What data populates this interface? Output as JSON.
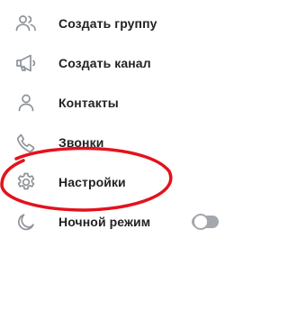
{
  "menu": {
    "items": [
      {
        "label": "Создать группу",
        "icon": "group-icon"
      },
      {
        "label": "Создать канал",
        "icon": "megaphone-icon"
      },
      {
        "label": "Контакты",
        "icon": "person-icon"
      },
      {
        "label": "Звонки",
        "icon": "phone-icon"
      },
      {
        "label": "Настройки",
        "icon": "gear-icon"
      },
      {
        "label": "Ночной режим",
        "icon": "moon-icon",
        "toggle_on": false
      }
    ]
  },
  "colors": {
    "icon": "#8e9399",
    "text": "#222222",
    "toggle_off": "#a4a8ad",
    "annotation": "#e3121d"
  }
}
